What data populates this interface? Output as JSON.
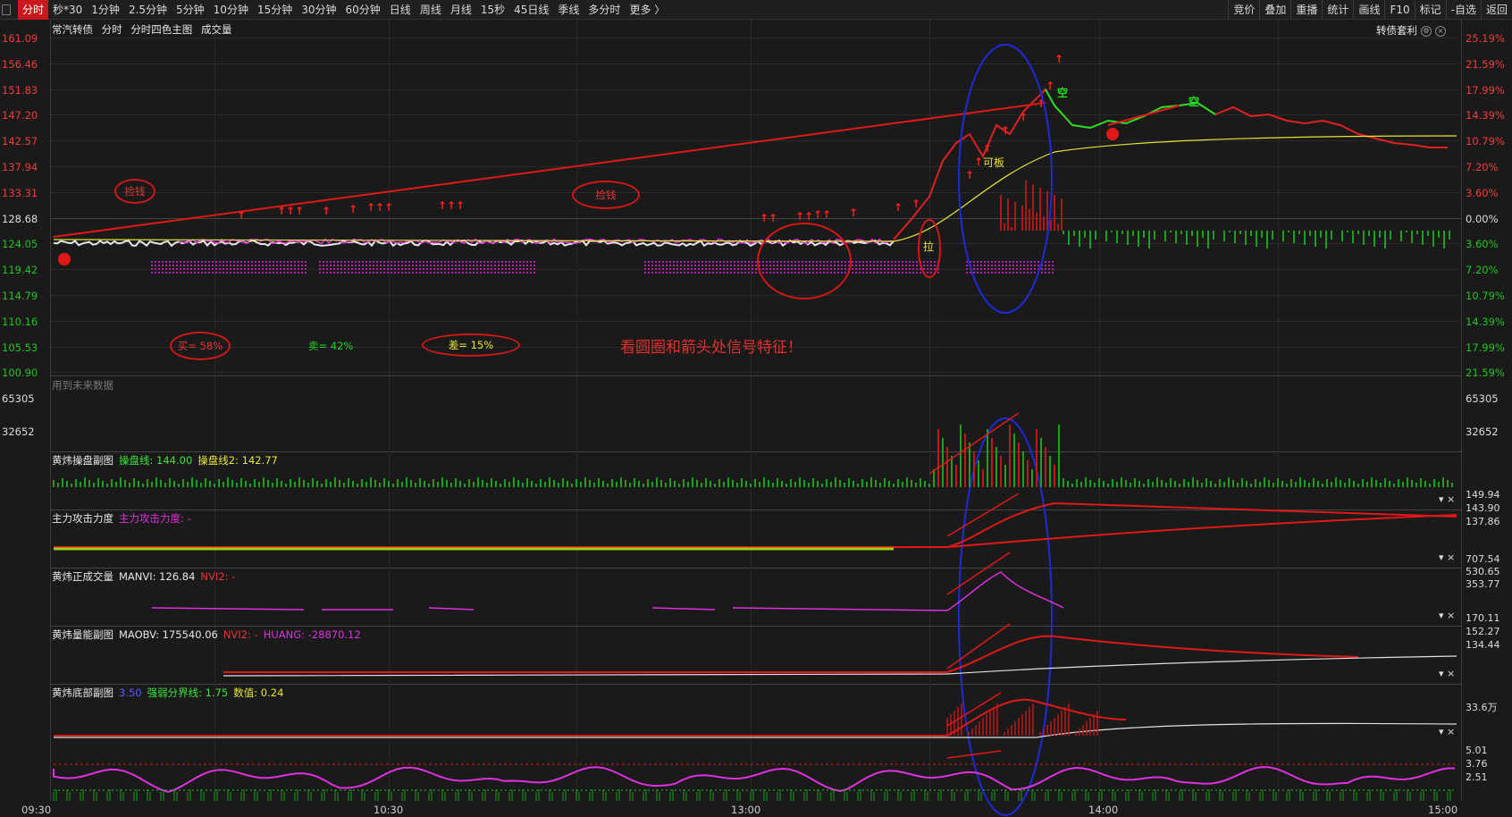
{
  "toolbar": {
    "tabs": [
      "分时",
      "秒*30",
      "1分钟",
      "2.5分钟",
      "5分钟",
      "10分钟",
      "15分钟",
      "30分钟",
      "60分钟",
      "日线",
      "周线",
      "月线",
      "15秒",
      "45日线",
      "季线",
      "多分时",
      "更多 〉"
    ],
    "active_tab": "分时",
    "right_buttons": [
      "竞价",
      "叠加",
      "重播",
      "统计",
      "画线",
      "F10",
      "标记",
      "-自选",
      "返回"
    ]
  },
  "main_panel": {
    "title": "常汽转债",
    "subtitle_items": [
      "分时",
      "分时四色主图",
      "成交量"
    ],
    "right_info": "转债套利",
    "price_labels": [
      "161.09",
      "156.46",
      "151.83",
      "147.20",
      "142.57",
      "137.94",
      "133.31",
      "128.68",
      "124.05",
      "119.42",
      "114.79",
      "110.16",
      "105.53",
      "100.90"
    ],
    "pct_labels": [
      "25.19%",
      "21.59%",
      "17.99%",
      "14.39%",
      "10.79%",
      "7.20%",
      "3.60%",
      "0.00%",
      "3.60%",
      "7.20%",
      "10.79%",
      "14.39%",
      "17.99%",
      "21.59%"
    ],
    "annotations": {
      "pick_money_1": "捡钱",
      "pick_money_2": "捡钱",
      "buy": "买= 58%",
      "sell": "卖= 42%",
      "diff": "差= 15%",
      "note": "看圆圈和箭头处信号特征！",
      "pull": "拉",
      "board": "可板",
      "short_1": "空",
      "short_2": "空"
    }
  },
  "volume_panel": {
    "title": "用到未来数据",
    "labels": [
      "65305",
      "32652"
    ]
  },
  "sub_panels": [
    {
      "name": "黄炜操盘副图",
      "items": [
        {
          "text": "操盘线: 144.00",
          "color": "g"
        },
        {
          "text": "操盘线2: 142.77",
          "color": "y"
        }
      ],
      "labels": [
        "149.94",
        "143.90",
        "137.86"
      ]
    },
    {
      "name": "主力攻击力度",
      "items": [
        {
          "text": "主力攻击力度: -",
          "color": "m"
        }
      ],
      "labels": [
        "707.54",
        "530.65",
        "353.77"
      ]
    },
    {
      "name": "黄炜正成交量",
      "items": [
        {
          "text": "MANVI: 126.84",
          "color": "w"
        },
        {
          "text": "NVI2: -",
          "color": "r"
        }
      ],
      "labels": [
        "170.11",
        "152.27",
        "134.44"
      ]
    },
    {
      "name": "黄炜量能副图",
      "items": [
        {
          "text": "MAOBV: 175540.06",
          "color": "w"
        },
        {
          "text": "NVI2: -",
          "color": "r"
        },
        {
          "text": "HUANG: -28870.12",
          "color": "m"
        }
      ],
      "labels": [
        "33.6万"
      ]
    },
    {
      "name": "黄炜底部副图",
      "items": [
        {
          "text": "3.50",
          "color": "b"
        },
        {
          "text": "强弱分界线: 1.75",
          "color": "g"
        },
        {
          "text": "数值: 0.24",
          "color": "y"
        }
      ],
      "labels": [
        "5.01",
        "3.76",
        "2.51"
      ]
    }
  ],
  "time_axis": [
    "09:30",
    "10:30",
    "13:00",
    "14:00",
    "15:00"
  ],
  "colors": {
    "accent": "#c8191d",
    "up": "#f03c3c",
    "down": "#22c322",
    "circle": "#d01818",
    "ellipse": "#1e2ad8"
  }
}
